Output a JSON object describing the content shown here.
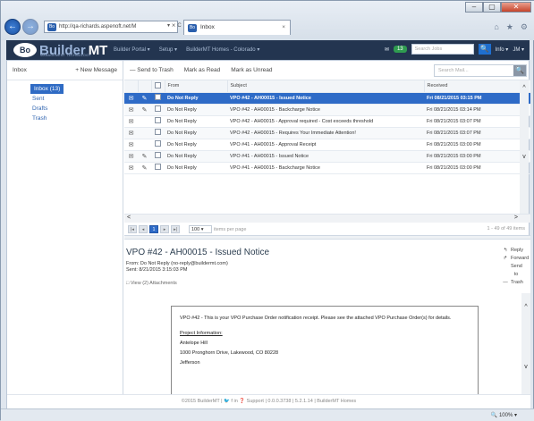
{
  "browser": {
    "address": "http://qa-richards.aspenoft.net/M",
    "address_controls": "▾ ⨯ C",
    "favicon_text": "Bo",
    "tab_title": "Inbox",
    "tab_close": "×",
    "window_buttons": {
      "minimize": "–",
      "maximize": "▢",
      "close": "✕"
    },
    "toolbar_icons": {
      "home": "⌂",
      "favorites": "★",
      "settings": "⚙"
    }
  },
  "app_header": {
    "logo_mark": "Bo",
    "logo_builder": "Builder",
    "logo_mt": "MT",
    "logo_tagline": "MANAGEMENT TECHNOLOGY",
    "nav": [
      "Builder Portal ▾",
      "Setup ▾",
      "BuilderMT Homes - Colorado ▾"
    ],
    "mail_icon": "✉",
    "mail_count": "13",
    "search_placeholder": "Search Jobs",
    "search_icon": "🔍",
    "info_menu": "Info ▾",
    "user_menu": "JM ▾"
  },
  "sidebar": {
    "title": "Inbox",
    "new_message": "+ New Message",
    "folders": [
      {
        "label": "Inbox (13)",
        "active": true
      },
      {
        "label": "Sent"
      },
      {
        "label": "Drafts"
      },
      {
        "label": "Trash"
      }
    ]
  },
  "toolbar": {
    "send_to_trash": "— Send to Trash",
    "mark_read": "Mark as Read",
    "mark_unread": "Mark as Unread",
    "search_placeholder": "Search Mail..."
  },
  "grid": {
    "columns": {
      "from": "From",
      "subject": "Subject",
      "received": "Received"
    },
    "rows": [
      {
        "selected": true,
        "attach": true,
        "from": "Do Not Reply",
        "subject": "VPO #42 - AH00015 - Issued Notice",
        "received": "Fri 08/21/2015 03:15 PM"
      },
      {
        "selected": false,
        "attach": true,
        "from": "Do Not Reply",
        "subject": "VPO #42 - AH00015 - Backcharge Notice",
        "received": "Fri 08/21/2015 03:14 PM"
      },
      {
        "selected": false,
        "attach": false,
        "from": "Do Not Reply",
        "subject": "VPO #42 - AH00015 - Approval required - Cost exceeds threshold",
        "received": "Fri 08/21/2015 03:07 PM"
      },
      {
        "selected": false,
        "attach": false,
        "from": "Do Not Reply",
        "subject": "VPO #42 - AH00015 - Requires Your Immediate Attention!",
        "received": "Fri 08/21/2015 03:07 PM"
      },
      {
        "selected": false,
        "attach": false,
        "from": "Do Not Reply",
        "subject": "VPO #41 - AH00015 - Approval Receipt",
        "received": "Fri 08/21/2015 03:00 PM"
      },
      {
        "selected": false,
        "attach": true,
        "from": "Do Not Reply",
        "subject": "VPO #41 - AH00015 - Issued Notice",
        "received": "Fri 08/21/2015 03:00 PM"
      },
      {
        "selected": false,
        "attach": true,
        "from": "Do Not Reply",
        "subject": "VPO #41 - AH00015 - Backcharge Notice",
        "received": "Fri 08/21/2015 03:00 PM"
      }
    ],
    "scroll_left": "<",
    "scroll_right": ">",
    "scroll_up": "^",
    "scroll_down": "v"
  },
  "pager": {
    "first": "|◂",
    "prev": "◂",
    "current": "1",
    "next": "▸",
    "last": "▸|",
    "page_size": "100 ▾",
    "items_per_page": "items per page",
    "count": "1 - 49 of 49 items"
  },
  "preview": {
    "title": "VPO #42 - AH00015 - Issued Notice",
    "from_line": "From: Do Not Reply (no-reply@buildermt.com)",
    "sent_line": "Sent: 8/21/2015 3:15:03 PM",
    "attachments": "View (2) Attachments",
    "actions": {
      "reply": "Reply",
      "forward": "Forward",
      "trash": "Send to Trash"
    },
    "action_icons": {
      "reply": "↰",
      "forward": "↱",
      "trash": "—"
    },
    "body": {
      "intro": "VPO #42 - This is your VPO Purchase Order notification receipt. Please see the attached VPO Purchase Order(s) for details.",
      "project_heading": "Project Information:",
      "community": "Antelope Hill",
      "address": "1000 Pronghorn Drive, Lakewood, CO 80228",
      "county": "Jefferson"
    }
  },
  "footer": "©2015 BuilderMT | 🐦 f in ❓ Support | 0.0.0.3738 | 5.2.1.14 | BuilderMT Homes",
  "statusbar": {
    "zoom": "🔍 100% ▾"
  }
}
